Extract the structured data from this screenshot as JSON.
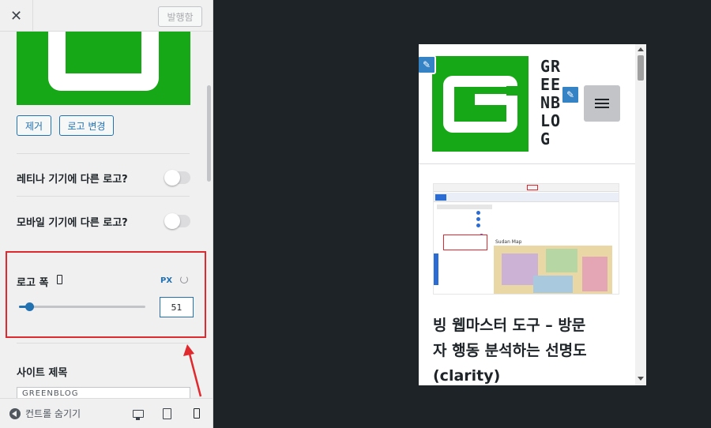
{
  "header": {
    "close_icon": "close-icon",
    "publish_label": "발행함"
  },
  "logo_section": {
    "remove_label": "제거",
    "change_label": "로고 변경"
  },
  "toggles": [
    {
      "label": "레티나 기기에 다른 로고?",
      "enabled": false
    },
    {
      "label": "모바일 기기에 다른 로고?",
      "enabled": false
    }
  ],
  "logo_width": {
    "label": "로고 폭",
    "device_icon": "mobile-icon",
    "unit": "PX",
    "reset_icon": "undo-icon",
    "value": "51",
    "slider_fraction": 0.08
  },
  "site_title_section": {
    "label": "사이트 제목",
    "input_value": "GREENBLOG"
  },
  "footer": {
    "hide_controls_label": "컨트롤 숨기기",
    "devices": [
      "desktop-icon",
      "tablet-icon",
      "mobile-icon"
    ],
    "active_device": "mobile-icon"
  },
  "preview": {
    "site_title_lines": [
      "GR",
      "EE",
      "NB",
      "LO",
      "G"
    ],
    "post_title_lines": [
      "빙 웹마스터 도구 – 방문",
      "자 행동 분석하는 선명도",
      "(clarity)"
    ],
    "thumbnail_map_label": "Sudan Map"
  },
  "colors": {
    "accent": "#2271b1",
    "highlight": "#e0292e",
    "logo_green": "#17a817",
    "backdrop": "#1d2327"
  }
}
